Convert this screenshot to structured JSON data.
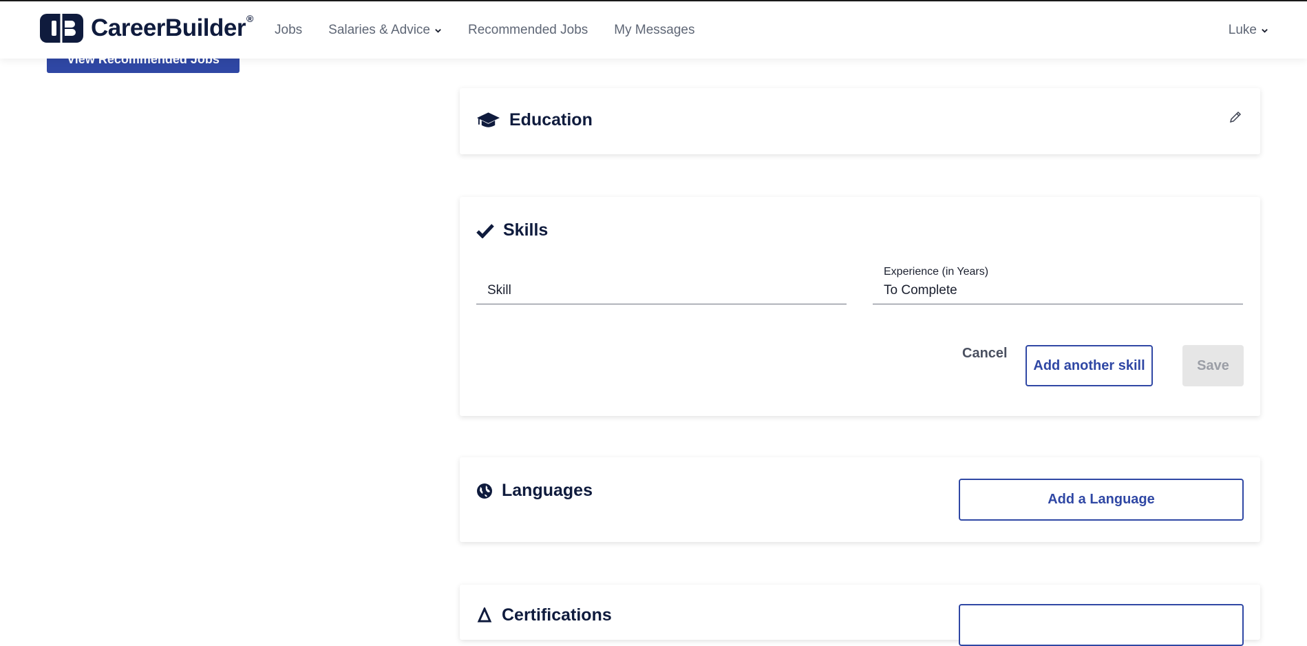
{
  "nav": {
    "brand": "CareerBuilder",
    "brand_mark": "®",
    "links": [
      "Jobs",
      "Salaries & Advice",
      "Recommended Jobs",
      "My Messages"
    ],
    "user": "Luke"
  },
  "partial_button": "View Recommended Jobs",
  "education": {
    "title": "Education"
  },
  "skills": {
    "title": "Skills",
    "skill_placeholder": "Skill",
    "experience_label": "Experience (in Years)",
    "experience_value": "To Complete",
    "cancel": "Cancel",
    "add_another": "Add another skill",
    "save": "Save"
  },
  "languages": {
    "title": "Languages",
    "add": "Add a Language"
  },
  "certifications": {
    "title": "Certifications"
  },
  "colors": {
    "brand": "#0f1b3d",
    "accent": "#2f47a4",
    "disabled": "#e6e6e6"
  },
  "icons": [
    "graduation-cap-icon",
    "check-icon",
    "globe-icon",
    "pencil-icon",
    "chevron-down-icon",
    "certificate-icon"
  ]
}
